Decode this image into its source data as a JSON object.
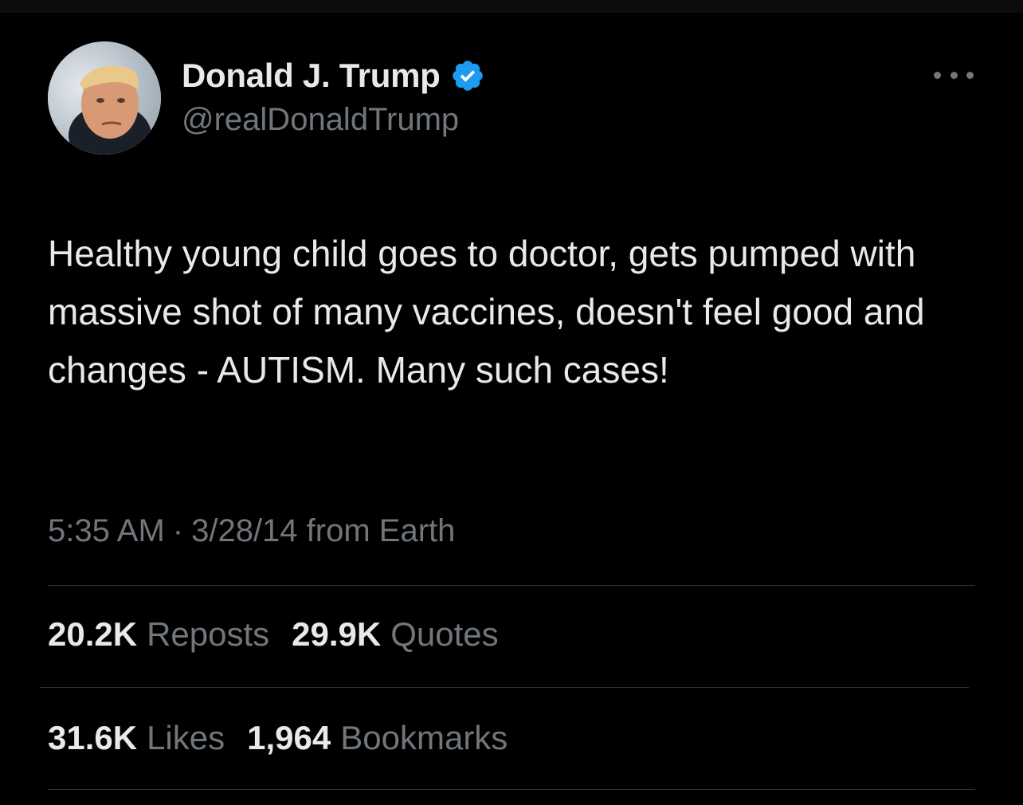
{
  "author": {
    "display_name": "Donald J. Trump",
    "handle": "@realDonaldTrump",
    "verified_icon": "verified-badge-icon",
    "verified_color": "#1d9bf0"
  },
  "tweet": {
    "text": "Healthy young child goes to doctor, gets pumped with massive shot of many vaccines, doesn't feel good and changes - AUTISM. Many such cases!",
    "time": "5:35 AM",
    "separator": "·",
    "date_source": "3/28/14 from Earth"
  },
  "stats": {
    "reposts_count": "20.2K",
    "reposts_label": "Reposts",
    "quotes_count": "29.9K",
    "quotes_label": "Quotes",
    "likes_count": "31.6K",
    "likes_label": "Likes",
    "bookmarks_count": "1,964",
    "bookmarks_label": "Bookmarks"
  },
  "theme": {
    "background": "#000000",
    "primary_text": "#e7e9ea",
    "secondary_text": "#71767b",
    "divider": "#2f3336"
  }
}
